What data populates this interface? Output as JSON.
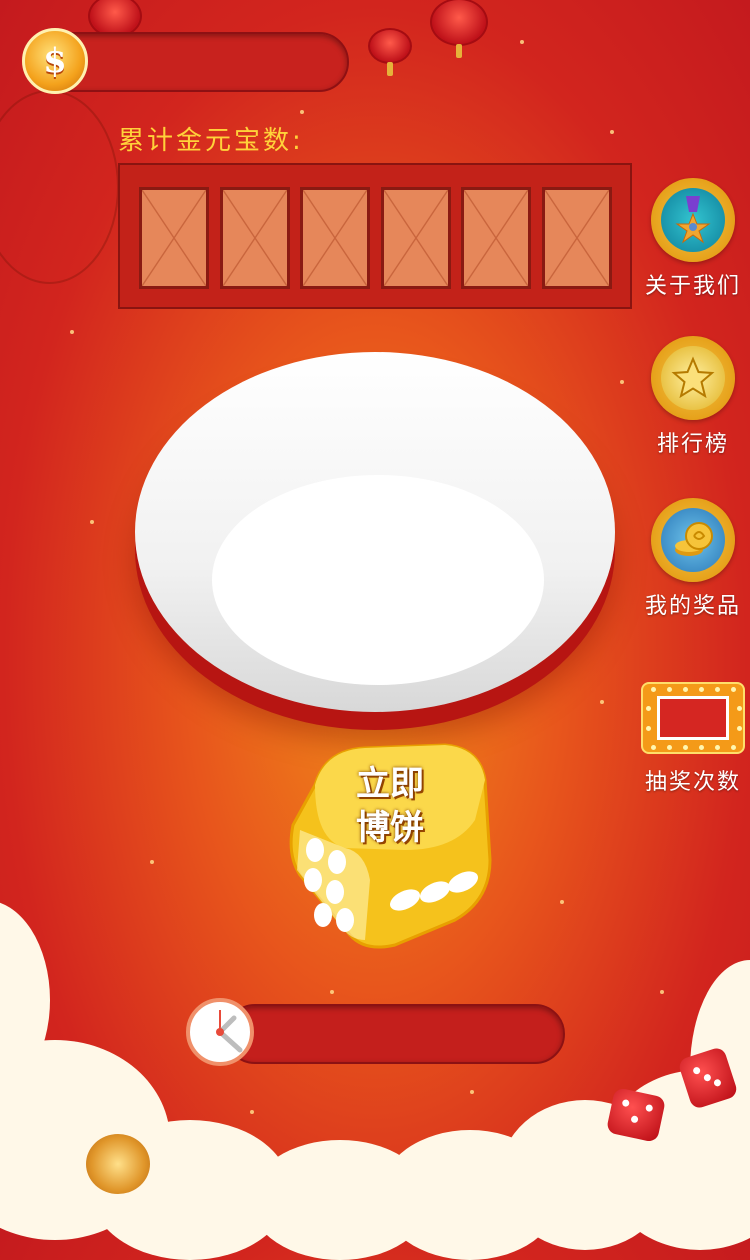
{
  "coin_bar": {
    "icon_glyph": "$",
    "value": ""
  },
  "total_label": "累计金元宝数:",
  "digits": [
    "",
    "",
    "",
    "",
    "",
    ""
  ],
  "dice_button": {
    "line1": "立即",
    "line2": "博饼"
  },
  "side_menu": [
    {
      "label": "关于我们",
      "icon": "medal-icon"
    },
    {
      "label": "排行榜",
      "icon": "star-icon"
    },
    {
      "label": "我的奖品",
      "icon": "gold-coins-icon"
    },
    {
      "label": "抽奖次数",
      "icon": "lottery-box-icon"
    }
  ],
  "timer_bar": {
    "icon": "clock-icon",
    "value": ""
  },
  "colors": {
    "background": "#d2251e",
    "accent_gold": "#ffd23a",
    "bowl_red": "#c91a16"
  }
}
